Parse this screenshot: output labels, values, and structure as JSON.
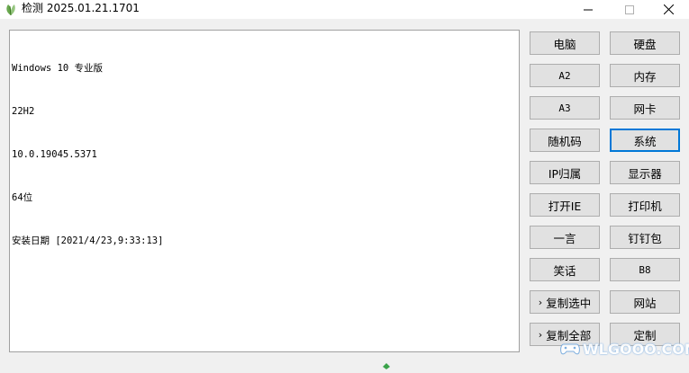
{
  "window": {
    "title": "检测 2025.01.21.1701"
  },
  "output": {
    "lines": [
      "Windows 10 专业版",
      "22H2",
      "10.0.19045.5371",
      "64位",
      "安装日期 [2021/4/23,9:33:13]"
    ]
  },
  "buttons": {
    "computer": "电脑",
    "disk": "硬盘",
    "a2": "A2",
    "memory": "内存",
    "a3": "A3",
    "nic": "网卡",
    "random_code": "随机码",
    "system": "系统",
    "ip_location": "IP归属",
    "display": "显示器",
    "open_ie": "打开IE",
    "printer": "打印机",
    "one_quote": "一言",
    "dingding": "钉钉包",
    "joke": "笑话",
    "b8": "B8",
    "copy_selected": "复制选中",
    "website": "网站",
    "copy_all": "复制全部",
    "custom": "定制"
  },
  "watermark": "WLGOOO.COM",
  "colors": {
    "focus": "#0078d7",
    "button_bg": "#e1e1e1",
    "button_border": "#adadad"
  }
}
